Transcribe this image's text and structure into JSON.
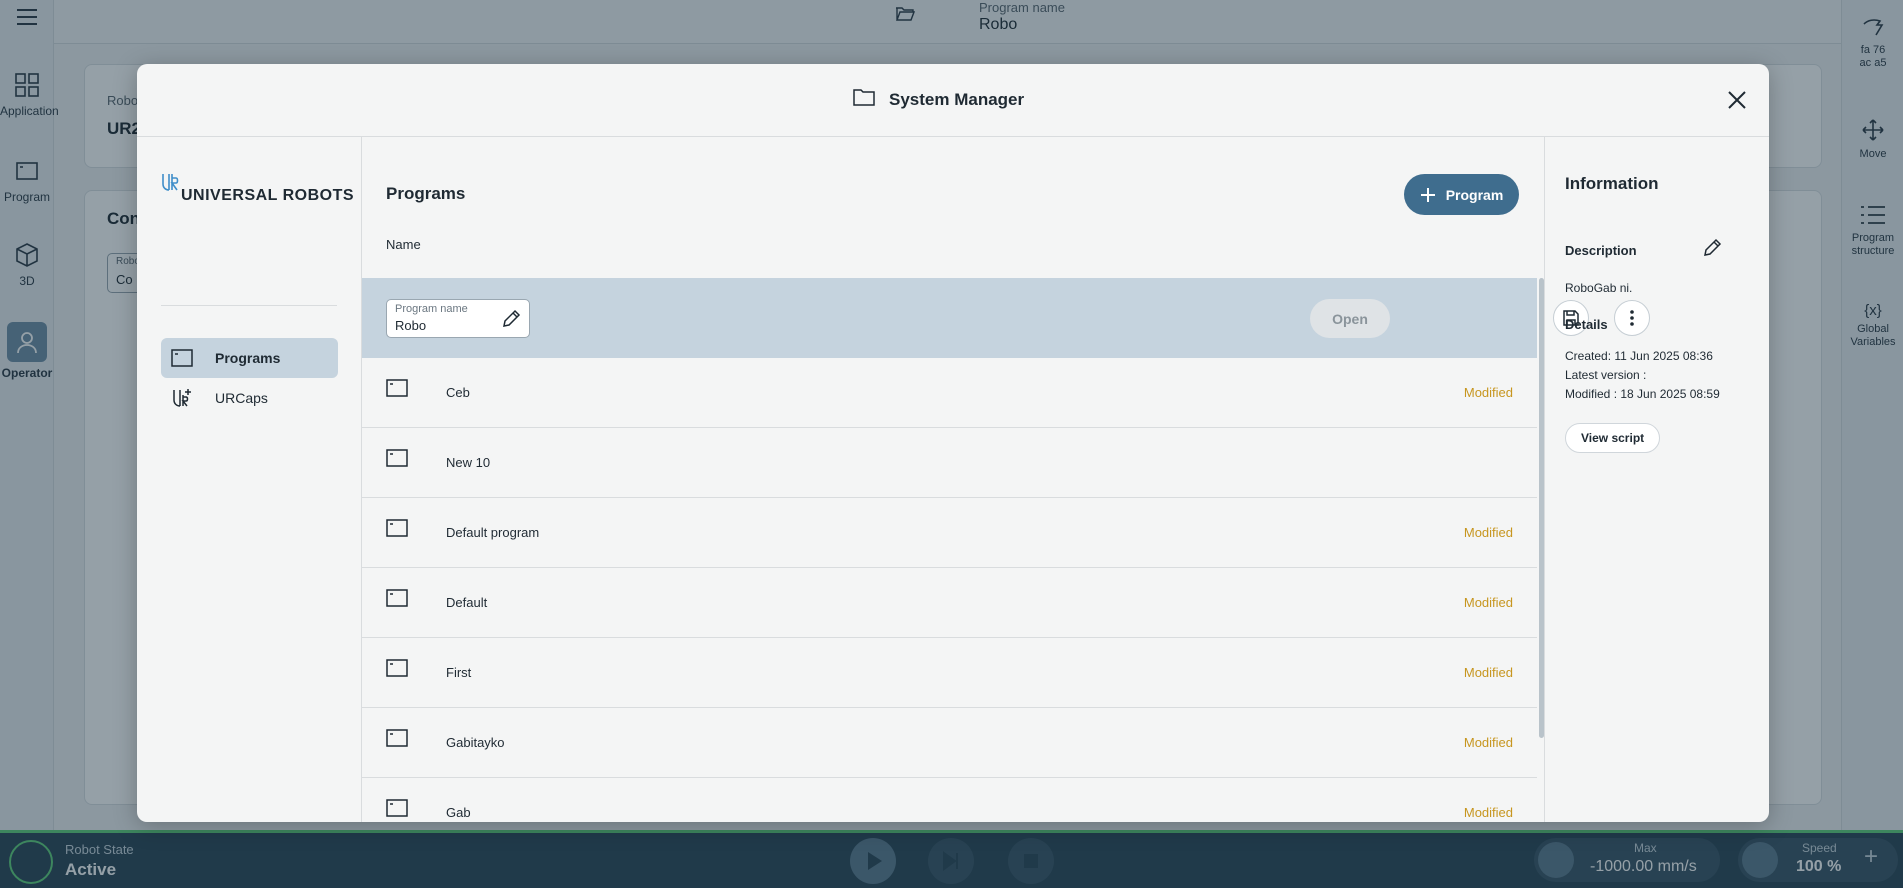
{
  "app": {
    "left_rail": [
      {
        "label": "Application",
        "icon": "grid-icon"
      },
      {
        "label": "Program",
        "icon": "program-icon"
      },
      {
        "label": "3D",
        "icon": "cube-icon"
      },
      {
        "label": "Operator",
        "icon": "user-icon"
      }
    ],
    "right_rail": [
      {
        "label": "fa 76\nac a5",
        "icon": "hand-icon"
      },
      {
        "label": "Move",
        "icon": "move-arrows-icon"
      },
      {
        "label": "Program\nstructure",
        "icon": "list-icon"
      },
      {
        "label": "Global\nVariables",
        "icon": "variables-icon"
      }
    ],
    "top": {
      "program_name_label": "Program name",
      "program_name_value": "Robo"
    },
    "background": {
      "robot_label": "Robo",
      "robot_value": "UR2",
      "con_label": "Con",
      "con_field_label": "Robo",
      "con_field_value": "Co"
    },
    "bottom": {
      "robot_state_label": "Robot State",
      "robot_state_value": "Active",
      "max_label": "Max",
      "max_value": "-1000.00 mm/s",
      "speed_label": "Speed",
      "speed_value": "100 %"
    }
  },
  "modal": {
    "title": "System Manager",
    "logo_text": "UNIVERSAL ROBOTS",
    "nav": [
      {
        "label": "Programs",
        "icon": "program-icon",
        "active": true
      },
      {
        "label": "URCaps",
        "icon": "urcaps-icon",
        "active": false
      }
    ],
    "programs_title": "Programs",
    "add_program_label": "Program",
    "column_name": "Name",
    "selected": {
      "field_label": "Program name",
      "field_value": "Robo",
      "open_label": "Open"
    },
    "rows": [
      {
        "name": "Ceb",
        "status": "Modified"
      },
      {
        "name": "New 10",
        "status": ""
      },
      {
        "name": "Default program",
        "status": "Modified"
      },
      {
        "name": "Default",
        "status": "Modified"
      },
      {
        "name": "First",
        "status": "Modified"
      },
      {
        "name": "Gabitayko",
        "status": "Modified"
      },
      {
        "name": "Gab",
        "status": "Modified"
      }
    ],
    "info": {
      "title": "Information",
      "description_heading": "Description",
      "description": "RoboGab ni.",
      "details_heading": "Details",
      "created": "Created: 11 Jun 2025 08:36",
      "latest_version": "Latest version :",
      "modified": "Modified : 18 Jun 2025 08:59",
      "view_script_label": "View script"
    }
  },
  "colors": {
    "accent": "#3f6d8e",
    "modified": "#c7961f",
    "selected_row": "#c5d3de",
    "status_bar": "#2b4657",
    "active_green": "#5fcf7a"
  }
}
